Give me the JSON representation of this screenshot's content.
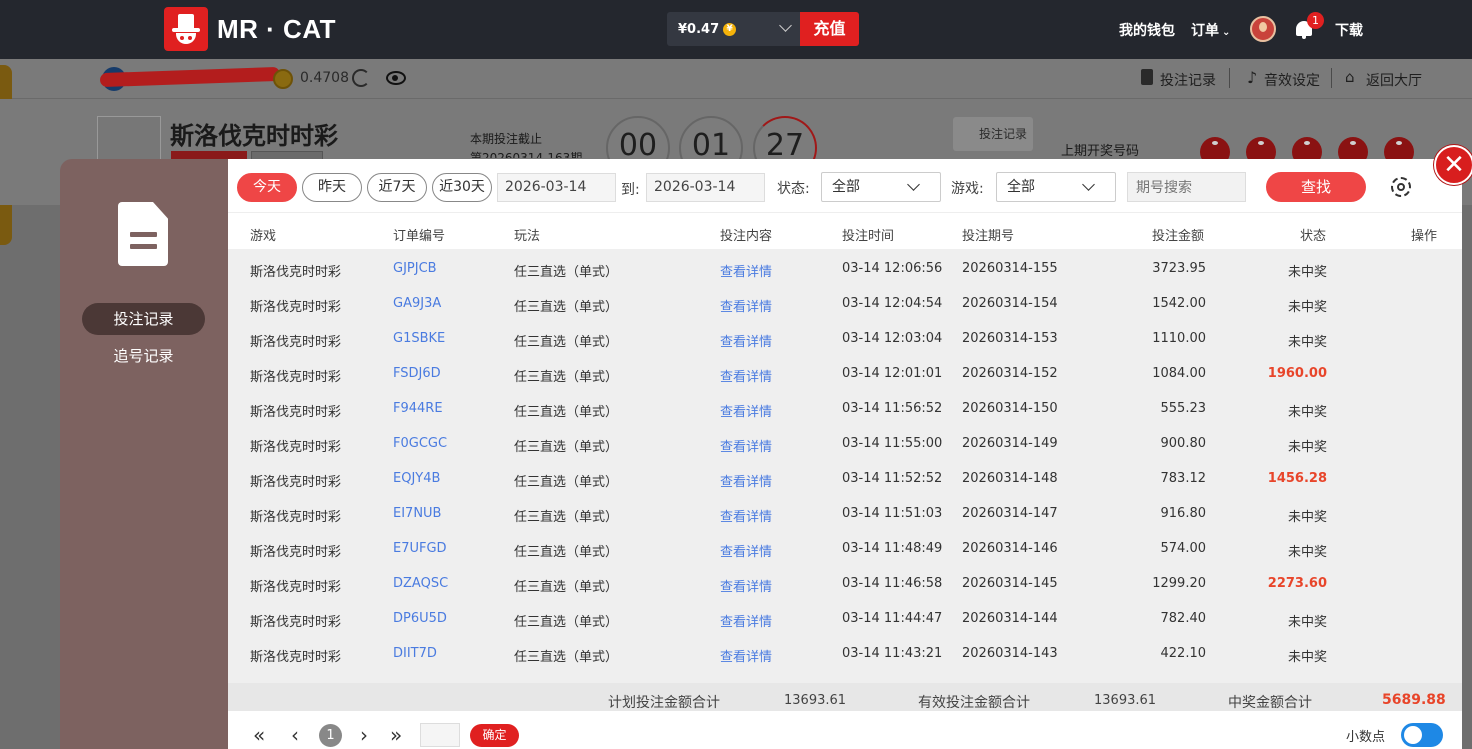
{
  "header": {
    "brand": "MR · CAT",
    "balance": "¥0.47",
    "coin_symbol": "¥",
    "recharge_label": "充值",
    "wallet_label": "我的钱包",
    "orders_label": "订单",
    "notification_count": "1",
    "download_label": "下载"
  },
  "subbar": {
    "balance": "0.4708",
    "bet_record_label": "投注记录",
    "sound_label": "音效设定",
    "lobby_label": "返回大厅"
  },
  "game": {
    "title": "斯洛伐克时时彩",
    "close_notice": "本期投注截止",
    "period_notice": "第20260314-163期",
    "timer": [
      "00",
      "01",
      "27"
    ],
    "record_button": "投注记录",
    "last_draw_label": "上期开奖号码"
  },
  "sidebar": {
    "items": [
      {
        "label": "投注记录",
        "active": true
      },
      {
        "label": "追号记录",
        "active": false
      }
    ]
  },
  "filters": {
    "ranges": [
      "今天",
      "昨天",
      "近7天",
      "近30天"
    ],
    "date_from": "2026-03-14",
    "to_label": "到:",
    "date_to": "2026-03-14",
    "status_label": "状态:",
    "status_value": "全部",
    "game_label": "游戏:",
    "game_value": "全部",
    "search_placeholder": "期号搜索",
    "search_button": "查找"
  },
  "table": {
    "columns": [
      "游戏",
      "订单编号",
      "玩法",
      "投注内容",
      "投注时间",
      "投注期号",
      "投注金额",
      "状态",
      "操作"
    ],
    "rows": [
      {
        "game": "斯洛伐克时时彩",
        "order": "GJPJCB",
        "play": "任三直选（单式）",
        "content": "查看详情",
        "time": "03-14 12:06:56",
        "period": "20260314-155",
        "amount": "3723.95",
        "status": "未中奖",
        "win": false
      },
      {
        "game": "斯洛伐克时时彩",
        "order": "GA9J3A",
        "play": "任三直选（单式）",
        "content": "查看详情",
        "time": "03-14 12:04:54",
        "period": "20260314-154",
        "amount": "1542.00",
        "status": "未中奖",
        "win": false
      },
      {
        "game": "斯洛伐克时时彩",
        "order": "G1SBKE",
        "play": "任三直选（单式）",
        "content": "查看详情",
        "time": "03-14 12:03:04",
        "period": "20260314-153",
        "amount": "1110.00",
        "status": "未中奖",
        "win": false
      },
      {
        "game": "斯洛伐克时时彩",
        "order": "FSDJ6D",
        "play": "任三直选（单式）",
        "content": "查看详情",
        "time": "03-14 12:01:01",
        "period": "20260314-152",
        "amount": "1084.00",
        "status": "1960.00",
        "win": true
      },
      {
        "game": "斯洛伐克时时彩",
        "order": "F944RE",
        "play": "任三直选（单式）",
        "content": "查看详情",
        "time": "03-14 11:56:52",
        "period": "20260314-150",
        "amount": "555.23",
        "status": "未中奖",
        "win": false
      },
      {
        "game": "斯洛伐克时时彩",
        "order": "F0GCGC",
        "play": "任三直选（单式）",
        "content": "查看详情",
        "time": "03-14 11:55:00",
        "period": "20260314-149",
        "amount": "900.80",
        "status": "未中奖",
        "win": false
      },
      {
        "game": "斯洛伐克时时彩",
        "order": "EQJY4B",
        "play": "任三直选（单式）",
        "content": "查看详情",
        "time": "03-14 11:52:52",
        "period": "20260314-148",
        "amount": "783.12",
        "status": "1456.28",
        "win": true
      },
      {
        "game": "斯洛伐克时时彩",
        "order": "EI7NUB",
        "play": "任三直选（单式）",
        "content": "查看详情",
        "time": "03-14 11:51:03",
        "period": "20260314-147",
        "amount": "916.80",
        "status": "未中奖",
        "win": false
      },
      {
        "game": "斯洛伐克时时彩",
        "order": "E7UFGD",
        "play": "任三直选（单式）",
        "content": "查看详情",
        "time": "03-14 11:48:49",
        "period": "20260314-146",
        "amount": "574.00",
        "status": "未中奖",
        "win": false
      },
      {
        "game": "斯洛伐克时时彩",
        "order": "DZAQSC",
        "play": "任三直选（单式）",
        "content": "查看详情",
        "time": "03-14 11:46:58",
        "period": "20260314-145",
        "amount": "1299.20",
        "status": "2273.60",
        "win": true
      },
      {
        "game": "斯洛伐克时时彩",
        "order": "DP6U5D",
        "play": "任三直选（单式）",
        "content": "查看详情",
        "time": "03-14 11:44:47",
        "period": "20260314-144",
        "amount": "782.40",
        "status": "未中奖",
        "win": false
      },
      {
        "game": "斯洛伐克时时彩",
        "order": "DIIT7D",
        "play": "任三直选（单式）",
        "content": "查看详情",
        "time": "03-14 11:43:21",
        "period": "20260314-143",
        "amount": "422.10",
        "status": "未中奖",
        "win": false
      }
    ]
  },
  "summary": {
    "planned_label": "计划投注金额合计",
    "planned_value": "13693.61",
    "valid_label": "有效投注金额合计",
    "valid_value": "13693.61",
    "win_label": "中奖金额合计",
    "win_value": "5689.88"
  },
  "pager": {
    "current_page": "1",
    "ok_label": "确定",
    "decimal_label": "小数点",
    "decimal_enabled": true
  },
  "colors": {
    "accent": "#ef4646",
    "link": "#4a7be0",
    "win": "#e8452a",
    "toggle": "#1e88e5"
  }
}
